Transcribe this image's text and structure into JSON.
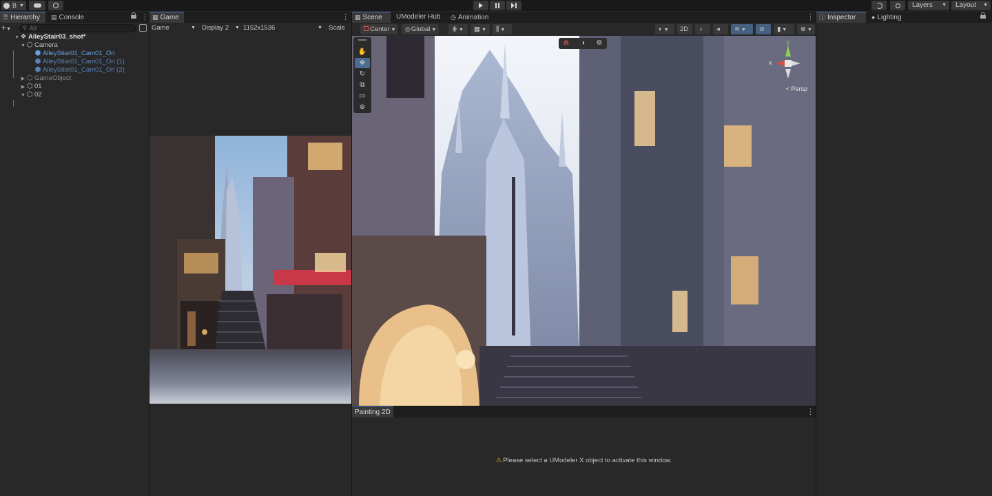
{
  "toolbar": {
    "account_label": "B",
    "layers_label": "Layers",
    "layout_label": "Layout"
  },
  "hierarchy": {
    "tab_label": "Hierarchy",
    "console_tab_label": "Console",
    "search_placeholder": "All",
    "items": [
      {
        "label": "AlleyStair03_shot*",
        "level": 0
      },
      {
        "label": "Camera",
        "level": 1
      },
      {
        "label": "AlleyStiar01_Cam01_Ori",
        "level": 2
      },
      {
        "label": "AlleyStiar01_Cam01_Ori (1)",
        "level": 2
      },
      {
        "label": "AlleyStiar01_Cam01_Ori (2)",
        "level": 2
      },
      {
        "label": "GameObject",
        "level": 1
      },
      {
        "label": "01",
        "level": 1
      },
      {
        "label": "02",
        "level": 1
      }
    ]
  },
  "game": {
    "tab_label": "Game",
    "mode_label": "Game",
    "display_label": "Display 2",
    "resolution_label": "1152x1536",
    "scale_label": "Scale"
  },
  "scene": {
    "tab_label": "Scene",
    "hub_tab_label": "UModeler Hub",
    "animation_tab_label": "Animation",
    "pivot_label": "Center",
    "space_label": "Global",
    "mode_2d_label": "2D",
    "persp_label": "< Persp",
    "axis_x": "x",
    "axis_y": "y"
  },
  "painting": {
    "tab_label": "Painting 2D",
    "message": "Please select a UModeler X object to activate this window."
  },
  "inspector": {
    "tab_label": "Inspector",
    "lighting_tab_label": "Lighting"
  },
  "colors": {
    "accent": "#4a78c2",
    "prefab_text": "#6aa0e6",
    "warning": "#f2b21b",
    "panel_bg": "#282828"
  }
}
